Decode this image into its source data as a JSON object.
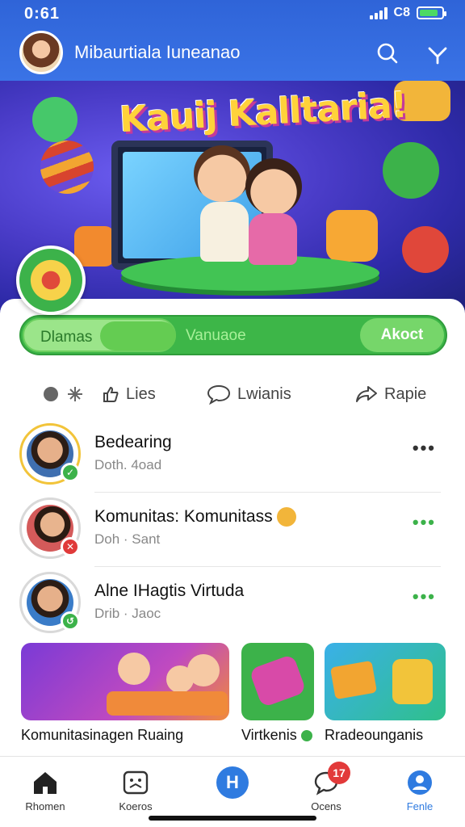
{
  "status_bar": {
    "time": "0:61",
    "carrier": "C8",
    "battery_level": 0.85
  },
  "header": {
    "title": "Mibaurtiala Iuneanao",
    "search_icon": "search-icon",
    "menu_icon": "chevron-down-icon"
  },
  "hero": {
    "title": "Kauij Kalltaria!"
  },
  "toggle": {
    "left_label": "Dlamas",
    "middle_label": "Vanuaoe",
    "right_label": "Akoct"
  },
  "actions": [
    {
      "label": "Lies",
      "icon": "like-icon"
    },
    {
      "label": "Lwianis",
      "icon": "comment-icon"
    },
    {
      "label": "Rapie",
      "icon": "share-icon"
    }
  ],
  "feed": [
    {
      "name": "Bedearing",
      "sub": "Doth. 4oad",
      "more_color": "#333333",
      "badge_color": "#3cb24a",
      "badge_glyph": "✓"
    },
    {
      "name": "Komunitas: Komunitass",
      "sub": "Doh · Sant",
      "more_color": "#3cb24a",
      "badge_color": "#e03a3a",
      "badge_glyph": "✕"
    },
    {
      "name": "Alne IHagtis Virtuda",
      "sub": "Drib · Jaoc",
      "more_color": "#3cb24a",
      "badge_color": "#3cb24a",
      "badge_glyph": "↺"
    }
  ],
  "tiles": [
    {
      "label": "Komunitasinagen Ruaing"
    },
    {
      "label": "Virtkenis"
    },
    {
      "label": "Rradeounganis"
    }
  ],
  "nav": [
    {
      "label": "Rhomen",
      "icon": "home-icon"
    },
    {
      "label": "Koeros",
      "icon": "game-icon"
    },
    {
      "label": "",
      "icon": "center-h-icon"
    },
    {
      "label": "Ocens",
      "icon": "chat-icon",
      "badge": "17"
    },
    {
      "label": "Fenle",
      "icon": "profile-icon"
    }
  ],
  "colors": {
    "primary": "#2f64d8",
    "accent_green": "#3db648",
    "active_nav": "#2f7be0"
  }
}
